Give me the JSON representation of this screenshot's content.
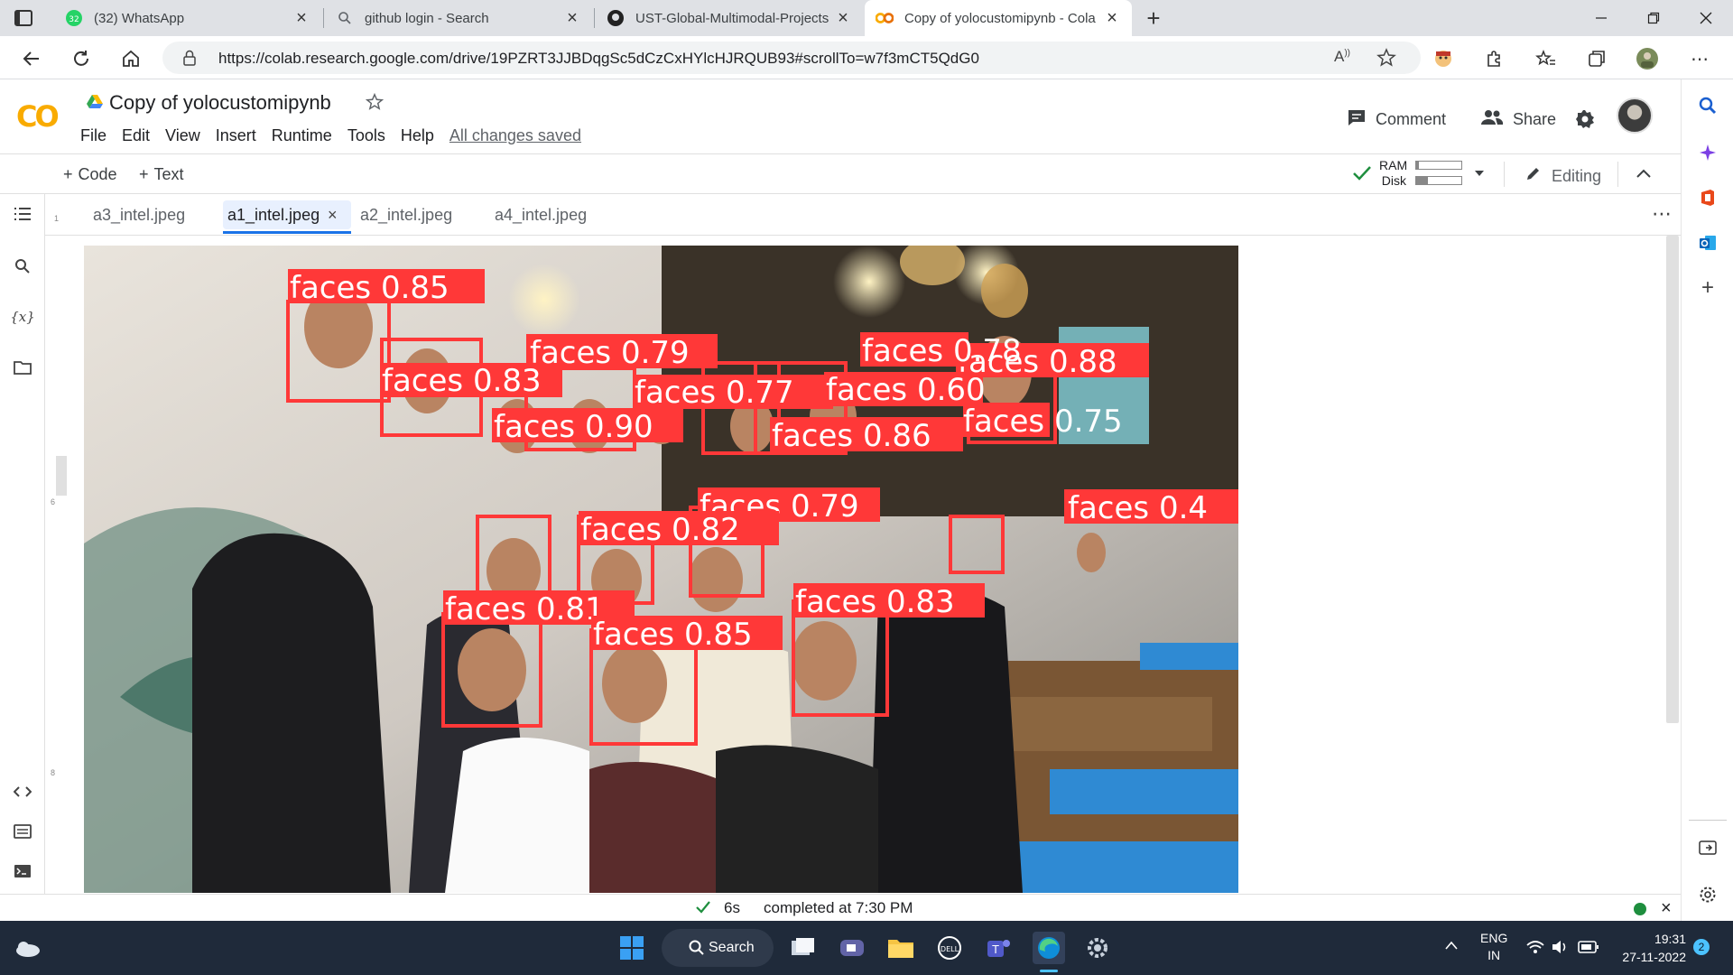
{
  "browser": {
    "tabs": [
      {
        "title": "(32) WhatsApp",
        "badge": "32",
        "icon": "whatsapp-icon"
      },
      {
        "title": "github login - Search",
        "icon": "search-icon"
      },
      {
        "title": "UST-Global-Multimodal-Projects",
        "icon": "github-icon"
      },
      {
        "title": "Copy of yolocustomipynb - Cola",
        "icon": "colab-icon"
      }
    ],
    "url": "https://colab.research.google.com/drive/19PZRT3JJBDqgSc5dCzCxHYlcHJRQUB93#scrollTo=w7f3mCT5QdG0"
  },
  "colab": {
    "logo": "CO",
    "title": "Copy of yolocustomipynb",
    "menu": [
      "File",
      "Edit",
      "View",
      "Insert",
      "Runtime",
      "Tools",
      "Help"
    ],
    "saved_status": "All changes saved",
    "comment_label": "Comment",
    "share_label": "Share",
    "toolbar": {
      "code_label": "Code",
      "text_label": "Text",
      "ram_label": "RAM",
      "disk_label": "Disk",
      "ram_fraction": 0.05,
      "disk_fraction": 0.25,
      "editing_label": "Editing"
    },
    "image_tabs": [
      "a3_intel.jpeg",
      "a1_intel.jpeg",
      "a2_intel.jpeg",
      "a4_intel.jpeg"
    ],
    "active_image_tab": "a1_intel.jpeg",
    "detections": [
      "faces 0.85",
      "faces 0.83",
      "faces 0.79",
      "faces 0.77",
      "faces 0.60",
      "faces 0.88",
      "faces 0.90",
      "faces 0.86",
      "faces 0.75",
      "faces 0.79",
      "faces 0.4",
      "faces 0.82",
      "faces 0.81",
      "faces 0.85",
      "faces 0.83",
      "faces 0.78"
    ],
    "status": {
      "duration": "6s",
      "completed": "completed at 7:30 PM"
    },
    "rail_numbers": [
      "1",
      "6",
      "8"
    ]
  },
  "taskbar": {
    "search_label": "Search",
    "lang": "ENG",
    "region": "IN",
    "time": "19:31",
    "date": "27-11-2022",
    "notifications": "2"
  }
}
